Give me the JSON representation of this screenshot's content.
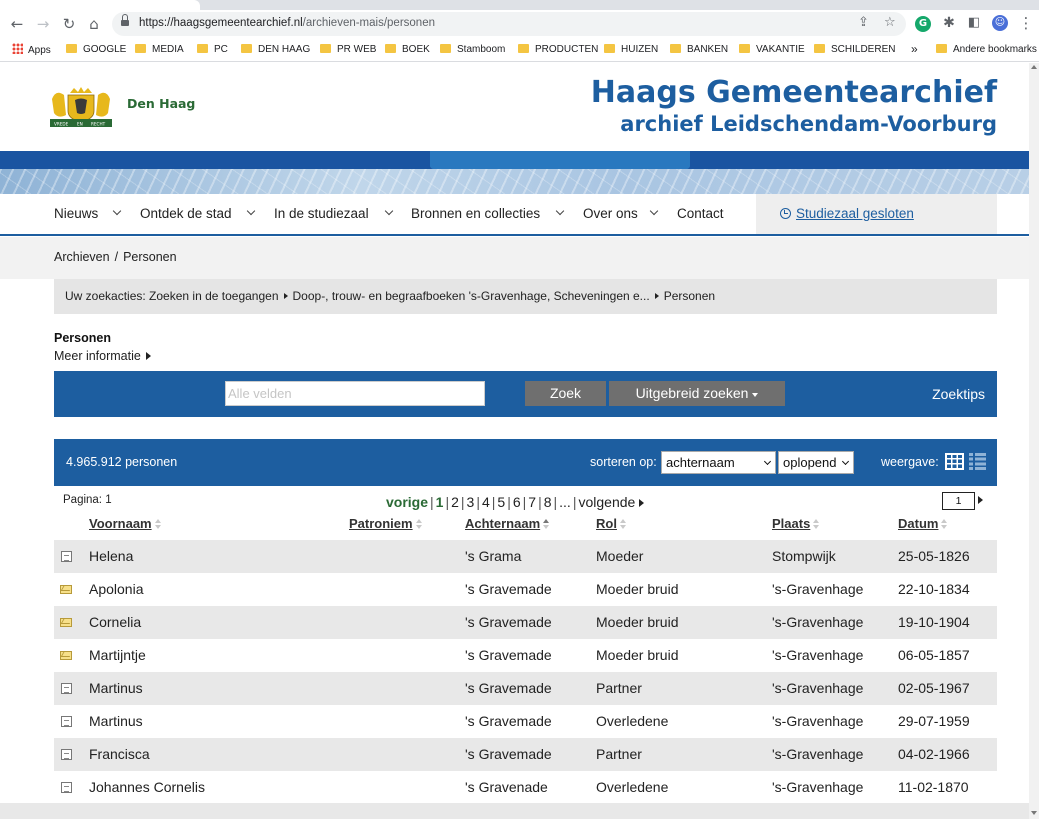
{
  "browser": {
    "url_host": "https://haagsgemeentearchief.nl",
    "url_path": "/archieven-mais/personen",
    "bookmarks": [
      "Apps",
      "GOOGLE",
      "MEDIA",
      "PC",
      "DEN HAAG",
      "PR WEB",
      "BOEK",
      "Stamboom",
      "PRODUCTEN",
      "HUIZEN",
      "BANKEN",
      "VAKANTIE",
      "SCHILDEREN"
    ],
    "overflow": "»",
    "other_bookmarks": "Andere bookmarks"
  },
  "header": {
    "city": "Den Haag",
    "title_line1": "Haags Gemeentearchief",
    "title_line2": "archief Leidschendam-Voorburg",
    "crest_motto": [
      "VREDE",
      "EN",
      "RECHT"
    ]
  },
  "nav": {
    "items": [
      "Nieuws",
      "Ontdek de stad",
      "In de studiezaal",
      "Bronnen en collecties",
      "Over ons",
      "Contact"
    ],
    "studiezaal": "Studiezaal gesloten"
  },
  "breadcrumb": {
    "root": "Archieven",
    "separator": "/",
    "current": "Personen"
  },
  "zoekacties": {
    "label": "Uw zoekacties:",
    "steps": [
      "Zoeken in de toegangen",
      "Doop-, trouw- en begraafboeken 's-Gravenhage, Scheveningen e...",
      "Personen"
    ]
  },
  "section": {
    "title": "Personen",
    "meer_info": "Meer informatie"
  },
  "search": {
    "placeholder": "Alle velden",
    "value": "",
    "zoek": "Zoek",
    "advanced": "Uitgebreid zoeken",
    "tips": "Zoektips"
  },
  "results": {
    "count": "4.965.912 personen",
    "sort_label": "sorteren op:",
    "sort_field": "achternaam",
    "sort_order": "oplopend",
    "view_label": "weergave:"
  },
  "pagination": {
    "pagina_label": "Pagina: 1",
    "prev": "vorige",
    "pages": [
      "1",
      "2",
      "3",
      "4",
      "5",
      "6",
      "7",
      "8",
      "..."
    ],
    "current": "1",
    "next": "volgende",
    "page_input": "1"
  },
  "table": {
    "columns": [
      "Voornaam",
      "Patroniem",
      "Achternaam",
      "Rol",
      "Plaats",
      "Datum"
    ],
    "rows": [
      {
        "icon": "document-icon",
        "voornaam": "Helena",
        "patroniem": "",
        "achternaam": "'s Grama",
        "rol": "Moeder",
        "plaats": "Stompwijk",
        "datum": "25-05-1826"
      },
      {
        "icon": "envelope-icon",
        "voornaam": "Apolonia",
        "patroniem": "",
        "achternaam": "'s Gravemade",
        "rol": "Moeder bruid",
        "plaats": "'s-Gravenhage",
        "datum": "22-10-1834"
      },
      {
        "icon": "envelope-icon",
        "voornaam": "Cornelia",
        "patroniem": "",
        "achternaam": "'s Gravemade",
        "rol": "Moeder bruid",
        "plaats": "'s-Gravenhage",
        "datum": "19-10-1904"
      },
      {
        "icon": "envelope-icon",
        "voornaam": "Martijntje",
        "patroniem": "",
        "achternaam": "'s Gravemade",
        "rol": "Moeder bruid",
        "plaats": "'s-Gravenhage",
        "datum": "06-05-1857"
      },
      {
        "icon": "document-icon",
        "voornaam": "Martinus",
        "patroniem": "",
        "achternaam": "'s Gravemade",
        "rol": "Partner",
        "plaats": "'s-Gravenhage",
        "datum": "02-05-1967"
      },
      {
        "icon": "document-icon",
        "voornaam": "Martinus",
        "patroniem": "",
        "achternaam": "'s Gravemade",
        "rol": "Overledene",
        "plaats": "'s-Gravenhage",
        "datum": "29-07-1959"
      },
      {
        "icon": "document-icon",
        "voornaam": "Francisca",
        "patroniem": "",
        "achternaam": "'s Gravemade",
        "rol": "Partner",
        "plaats": "'s-Gravenhage",
        "datum": "04-02-1966"
      },
      {
        "icon": "document-icon",
        "voornaam": "Johannes Cornelis",
        "patroniem": "",
        "achternaam": "'s Gravenade",
        "rol": "Overledene",
        "plaats": "'s-Gravenhage",
        "datum": "11-02-1870"
      }
    ]
  },
  "colors": {
    "brand_blue": "#1d5ea0",
    "green": "#2a6a35",
    "row_alt": "#e8e8e8"
  }
}
